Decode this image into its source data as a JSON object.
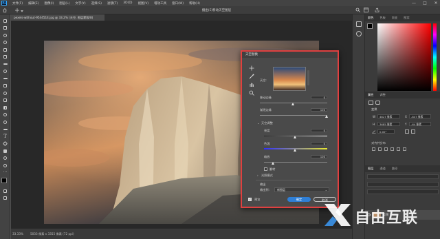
{
  "app": {
    "logo": "Ps",
    "menu": [
      "文件(F)",
      "编辑(E)",
      "图像(I)",
      "图层(L)",
      "文字(Y)",
      "选择(S)",
      "滤镜(T)",
      "3D(D)",
      "视图(V)",
      "增效工具",
      "窗口(W)",
      "帮助(H)"
    ],
    "title": "播出(E)移动天空图层",
    "window_controls": [
      "—",
      "□",
      "✕"
    ]
  },
  "toolbar_tools": [
    "move-tool-icon",
    "marquee-tool-icon",
    "lasso-tool-icon",
    "quick-select-icon",
    "crop-tool-icon",
    "frame-tool-icon",
    "eyedropper-icon",
    "healing-brush-icon",
    "brush-tool-icon",
    "clone-stamp-icon",
    "history-brush-icon",
    "eraser-icon",
    "gradient-tool-icon",
    "blur-tool-icon",
    "dodge-tool-icon",
    "pen-tool-icon",
    "type-tool-icon",
    "path-select-icon",
    "shape-tool-icon",
    "hand-tool-icon",
    "zoom-tool-icon",
    "more-tools-icon"
  ],
  "document": {
    "tab_label": "pexels-without-9544514.jpg @ 33.2% (天空, 图层蒙版/8)",
    "status_zoom": "33.33%",
    "status_info": "5033 像素 x 3355 像素 (72 ppi)"
  },
  "panels": {
    "color_tabs": [
      "颜色",
      "色板",
      "渐变",
      "图案"
    ],
    "properties_tabs": [
      "属性",
      "调整"
    ],
    "transform_title": "变换",
    "w_label": "W",
    "w_value": "4827 像素",
    "x_label": "X",
    "x_value": "-847 像素",
    "h_label": "H",
    "h_value": "3685 像素",
    "y_label": "Y",
    "y_value": "-64 像素",
    "angle_value": "0.00°",
    "align_title": "对齐并分布",
    "layers_tabs": [
      "图层",
      "通道",
      "路径"
    ],
    "layer_name": "背景",
    "fg_color": "#000000",
    "bg_color": "#ffffff"
  },
  "dialog": {
    "title": "天空替换",
    "sky_label": "天空:",
    "shift_edge_label": "移动边缘",
    "shift_edge_value": "0",
    "fade_edge_label": "渐隐边缘",
    "fade_edge_value": "100",
    "sky_adjust_label": "天空调整",
    "brightness_label": "亮度",
    "brightness_value": "0",
    "temperature_label": "色温",
    "temperature_value": "0",
    "scale_label": "缩放",
    "scale_value": "100",
    "flip_label": "翻转",
    "lighting_label": "光照模式",
    "output_title": "输出",
    "output_to_label": "输出到:",
    "output_to_value": "新图层",
    "preview_label": "预览",
    "ok_label": "确定",
    "cancel_label": "取消"
  },
  "watermark": {
    "text": "自由互联"
  }
}
